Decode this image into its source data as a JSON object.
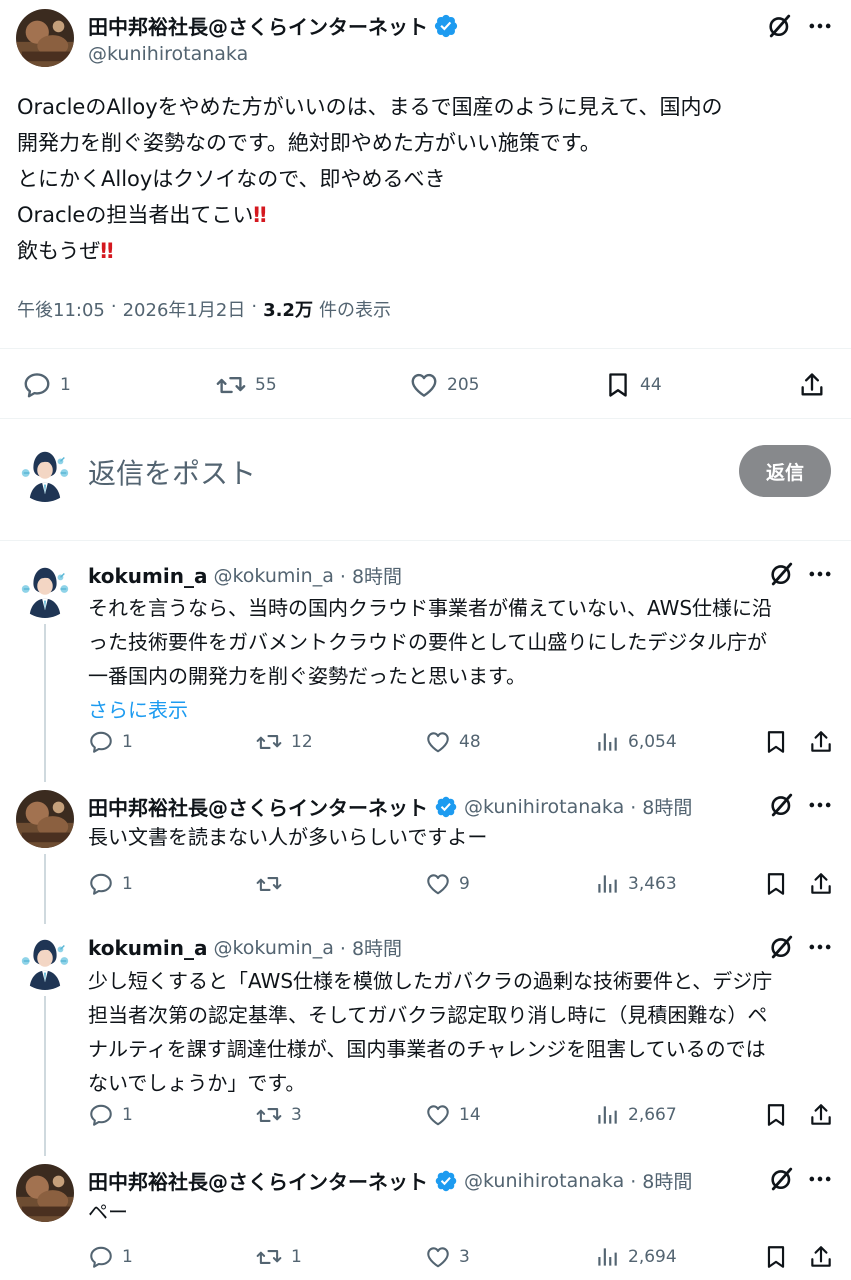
{
  "main_post": {
    "author_name": "田中邦裕社長@さくらインターネット",
    "author_handle": "@kunihirotanaka",
    "lines": [
      "OracleのAlloyをやめた方がいいのは、まるで国産のように見えて、国内の",
      "開発力を削ぐ姿勢なのです。絶対即やめた方がいい施策です。",
      "とにかくAlloyはクソイなので、即やめるべき",
      "Oracleの担当者出てこい",
      "飲もうぜ"
    ],
    "bang": "‼",
    "meta": {
      "time": "午後11:05",
      "sep": "·",
      "date": "2026年1月2日",
      "views": "3.2万",
      "views_label": "件の表示"
    },
    "stats": {
      "replies": "1",
      "reposts": "55",
      "likes": "205",
      "bookmarks": "44"
    }
  },
  "composer": {
    "placeholder": "返信をポスト",
    "button": "返信"
  },
  "replies": [
    {
      "name": "kokumin_a",
      "handle": "@kokumin_a",
      "time": "· 8時間",
      "lines": [
        "それを言うなら、当時の国内クラウド事業者が備えていない、AWS仕様に沿",
        "った技術要件をガバメントクラウドの要件として山盛りにしたデジタル庁が",
        "一番国内の開発力を削ぐ姿勢だったと思います。"
      ],
      "more": "さらに表示",
      "stats": {
        "replies": "1",
        "reposts": "12",
        "likes": "48",
        "views": "6,054"
      }
    },
    {
      "name": "田中邦裕社長@さくらインターネット",
      "handle": "@kunihirotanaka",
      "time": "· 8時間",
      "lines": [
        "長い文書を読まない人が多いらしいですよー"
      ],
      "stats": {
        "replies": "1",
        "reposts": "",
        "likes": "9",
        "views": "3,463"
      }
    },
    {
      "name": "kokumin_a",
      "handle": "@kokumin_a",
      "time": "· 8時間",
      "lines": [
        "少し短くすると「AWS仕様を模倣したガバクラの過剰な技術要件と、デジ庁",
        "担当者次第の認定基準、そしてガバクラ認定取り消し時に（見積困難な）ペ",
        "ナルティを課す調達仕様が、国内事業者のチャレンジを阻害しているのでは",
        "ないでしょうか」です。"
      ],
      "stats": {
        "replies": "1",
        "reposts": "3",
        "likes": "14",
        "views": "2,667"
      }
    },
    {
      "name": "田中邦裕社長@さくらインターネット",
      "handle": "@kunihirotanaka",
      "time": "· 8時間",
      "lines": [
        "ペー"
      ],
      "stats": {
        "replies": "1",
        "reposts": "1",
        "likes": "3",
        "views": "2,694"
      }
    }
  ],
  "icons": {
    "verified": "verified-badge-icon",
    "grok": "grok-icon",
    "more": "more-icon",
    "reply": "reply-icon",
    "repost": "repost-icon",
    "like": "like-icon",
    "bookmark": "bookmark-icon",
    "share": "share-icon",
    "views": "views-icon"
  },
  "colors": {
    "text": "#0f1419",
    "muted": "#536471",
    "link": "#1d9bf0",
    "verified": "#1d9bf0",
    "reply_button": "#87898c",
    "exclamation": "#d4181f"
  }
}
